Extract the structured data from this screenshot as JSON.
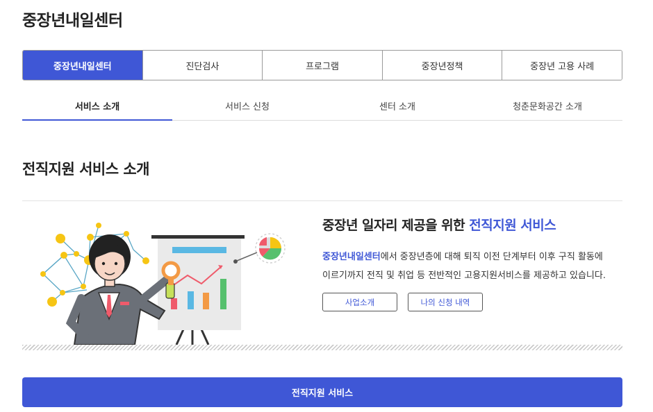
{
  "page": {
    "title": "중장년내일센터"
  },
  "main_tabs": [
    {
      "label": "중장년내일센터",
      "active": true
    },
    {
      "label": "진단검사"
    },
    {
      "label": "프로그램"
    },
    {
      "label": "중장년정책"
    },
    {
      "label": "중장년 고용 사례"
    }
  ],
  "sub_tabs": [
    {
      "label": "서비스 소개",
      "active": true
    },
    {
      "label": "서비스 신청"
    },
    {
      "label": "센터 소개"
    },
    {
      "label": "청춘문화공간 소개"
    }
  ],
  "section": {
    "title": "전직지원 서비스 소개"
  },
  "intro": {
    "headline_prefix": "중장년 일자리 제공을 위한 ",
    "headline_highlight": "전직지원 서비스",
    "desc_highlight": "중장년내일센터",
    "desc_line1_rest": "에서 중장년층에 대해 퇴직 이전 단계부터 이후 구직 활동에",
    "desc_line2": "이르기까지 전직 및 취업 등 전반적인 고용지원서비스를 제공하고 있습니다.",
    "buttons": {
      "business": "사업소개",
      "my_applications": "나의 신청 내역"
    }
  },
  "cta": {
    "label": "전직지원 서비스"
  },
  "colors": {
    "accent": "#3f57d6",
    "yellow": "#f6c514",
    "network": "#5aa7c6"
  }
}
